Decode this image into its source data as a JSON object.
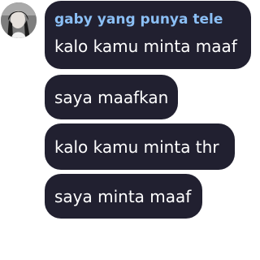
{
  "chat": {
    "sender": {
      "name": "gaby yang punya tele",
      "avatar_icon": "user-avatar",
      "name_color": "#8bbff5"
    },
    "bubble_color": "#212030",
    "messages": [
      {
        "text": "kalo kamu minta maaf"
      },
      {
        "text": "saya maafkan"
      },
      {
        "text": "kalo kamu minta thr"
      },
      {
        "text": "saya minta maaf"
      }
    ]
  }
}
